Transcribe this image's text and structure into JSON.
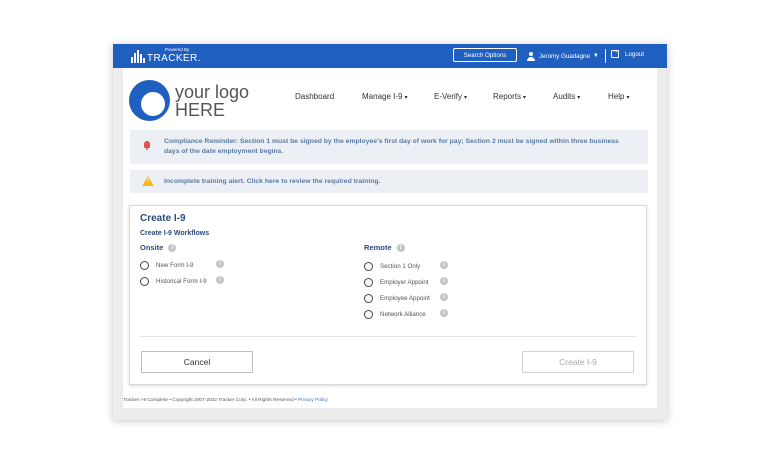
{
  "topbar": {
    "powered_by": "Powered By",
    "brand_name": "TRACKER.",
    "search_label": "Search Options",
    "user_name": "Jeromy Guadagne",
    "user_caret": "▼",
    "logout_label": "Logout"
  },
  "logo": {
    "line1": "your logo",
    "line2": "HERE"
  },
  "nav": {
    "items": [
      {
        "label": "Dashboard",
        "caret": ""
      },
      {
        "label": "Manage I-9",
        "caret": "▾"
      },
      {
        "label": "E-Verify",
        "caret": "▾"
      },
      {
        "label": "Reports",
        "caret": "▾"
      },
      {
        "label": "Audits",
        "caret": "▾"
      },
      {
        "label": "Help",
        "caret": "▾"
      }
    ]
  },
  "alerts": {
    "compliance": "Compliance Reminder: Section 1 must be signed by the employee's first day of work for pay; Section 2 must be signed within three business days of the date employment begins.",
    "training": "Incomplete training alert. Click here to review the required training.",
    "warn_glyph": "!"
  },
  "form": {
    "title": "Create I-9",
    "subtitle": "Create I-9 Workflows",
    "onsite": {
      "heading": "Onsite",
      "options": [
        "New Form I-9",
        "Historical Form I-9"
      ]
    },
    "remote": {
      "heading": "Remote",
      "options": [
        "Section 1 Only",
        "Employer Appoint",
        "Employee Appoint",
        "Network Alliance"
      ]
    },
    "info_glyph": "i",
    "cancel_label": "Cancel",
    "create_label": "Create I-9"
  },
  "footer": {
    "copyright": "Tracker I-9 Complete • Copyright 2007-2022 Tracker Corp. • All Rights Reserved •",
    "privacy": "Privacy Policy"
  },
  "colors": {
    "brand_blue": "#1f5fbf",
    "alert_bg": "#ecf0f5",
    "heading_blue": "#2a4d7a",
    "bell_red": "#e0514a",
    "warn_yellow": "#f2b81c"
  },
  "icons": [
    "tracker-logo-icon",
    "user-icon",
    "logout-icon",
    "bell-icon",
    "warning-icon",
    "info-icon",
    "radio-icon"
  ]
}
